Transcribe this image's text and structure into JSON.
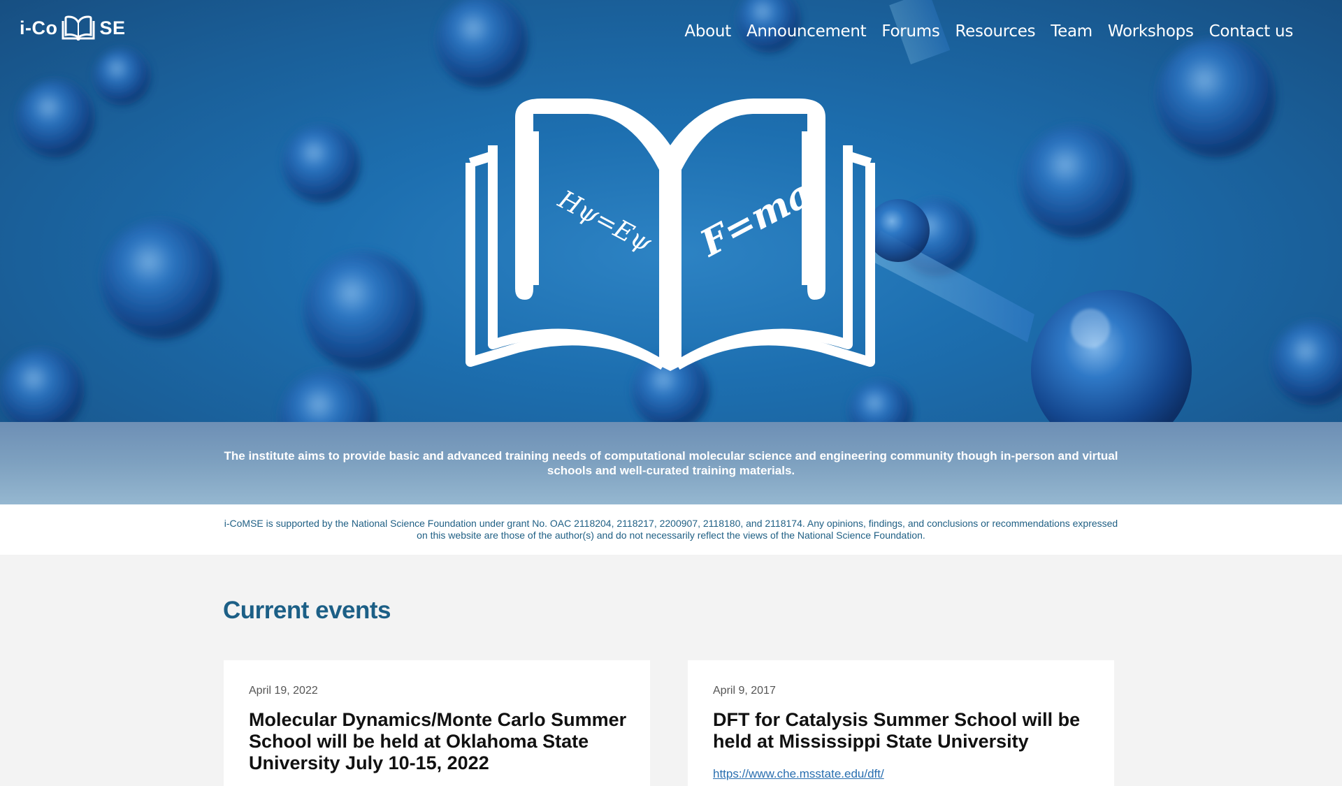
{
  "header": {
    "logo_left": "i-Co",
    "logo_right": "SE",
    "nav": [
      "About",
      "Announcement",
      "Forums",
      "Resources",
      "Team",
      "Workshops",
      "Contact us"
    ]
  },
  "hero": {
    "equation_left": "Hψ=Eψ",
    "equation_right": "F=ma"
  },
  "mission": {
    "text": "The institute aims to provide basic and advanced training needs of computational molecular science and engineering community though in-person and virtual schools and well-curated training materials."
  },
  "nsf_note": {
    "text": "i-CoMSE is supported by the National Science Foundation under grant No. OAC 2118204, 2118217, 2200907, 2118180, and 2118174. Any opinions, findings, and conclusions or recommendations expressed on this website are those of the author(s) and do not necessarily reflect the views of the National Science Foundation."
  },
  "events": {
    "heading": "Current events",
    "items": [
      {
        "date": "April 19, 2022",
        "title": "Molecular Dynamics/Monte Carlo Summer School will be held at Oklahoma State University July 10-15, 2022",
        "link": ""
      },
      {
        "date": "April 9, 2017",
        "title": "DFT for Catalysis Summer School will be held at Mississippi State University",
        "link": "https://www.che.msstate.edu/dft/"
      }
    ]
  },
  "colors": {
    "brand_blue": "#1c5f86",
    "hero_blue": "#1d6fb0",
    "link_blue": "#2a6fb0"
  }
}
